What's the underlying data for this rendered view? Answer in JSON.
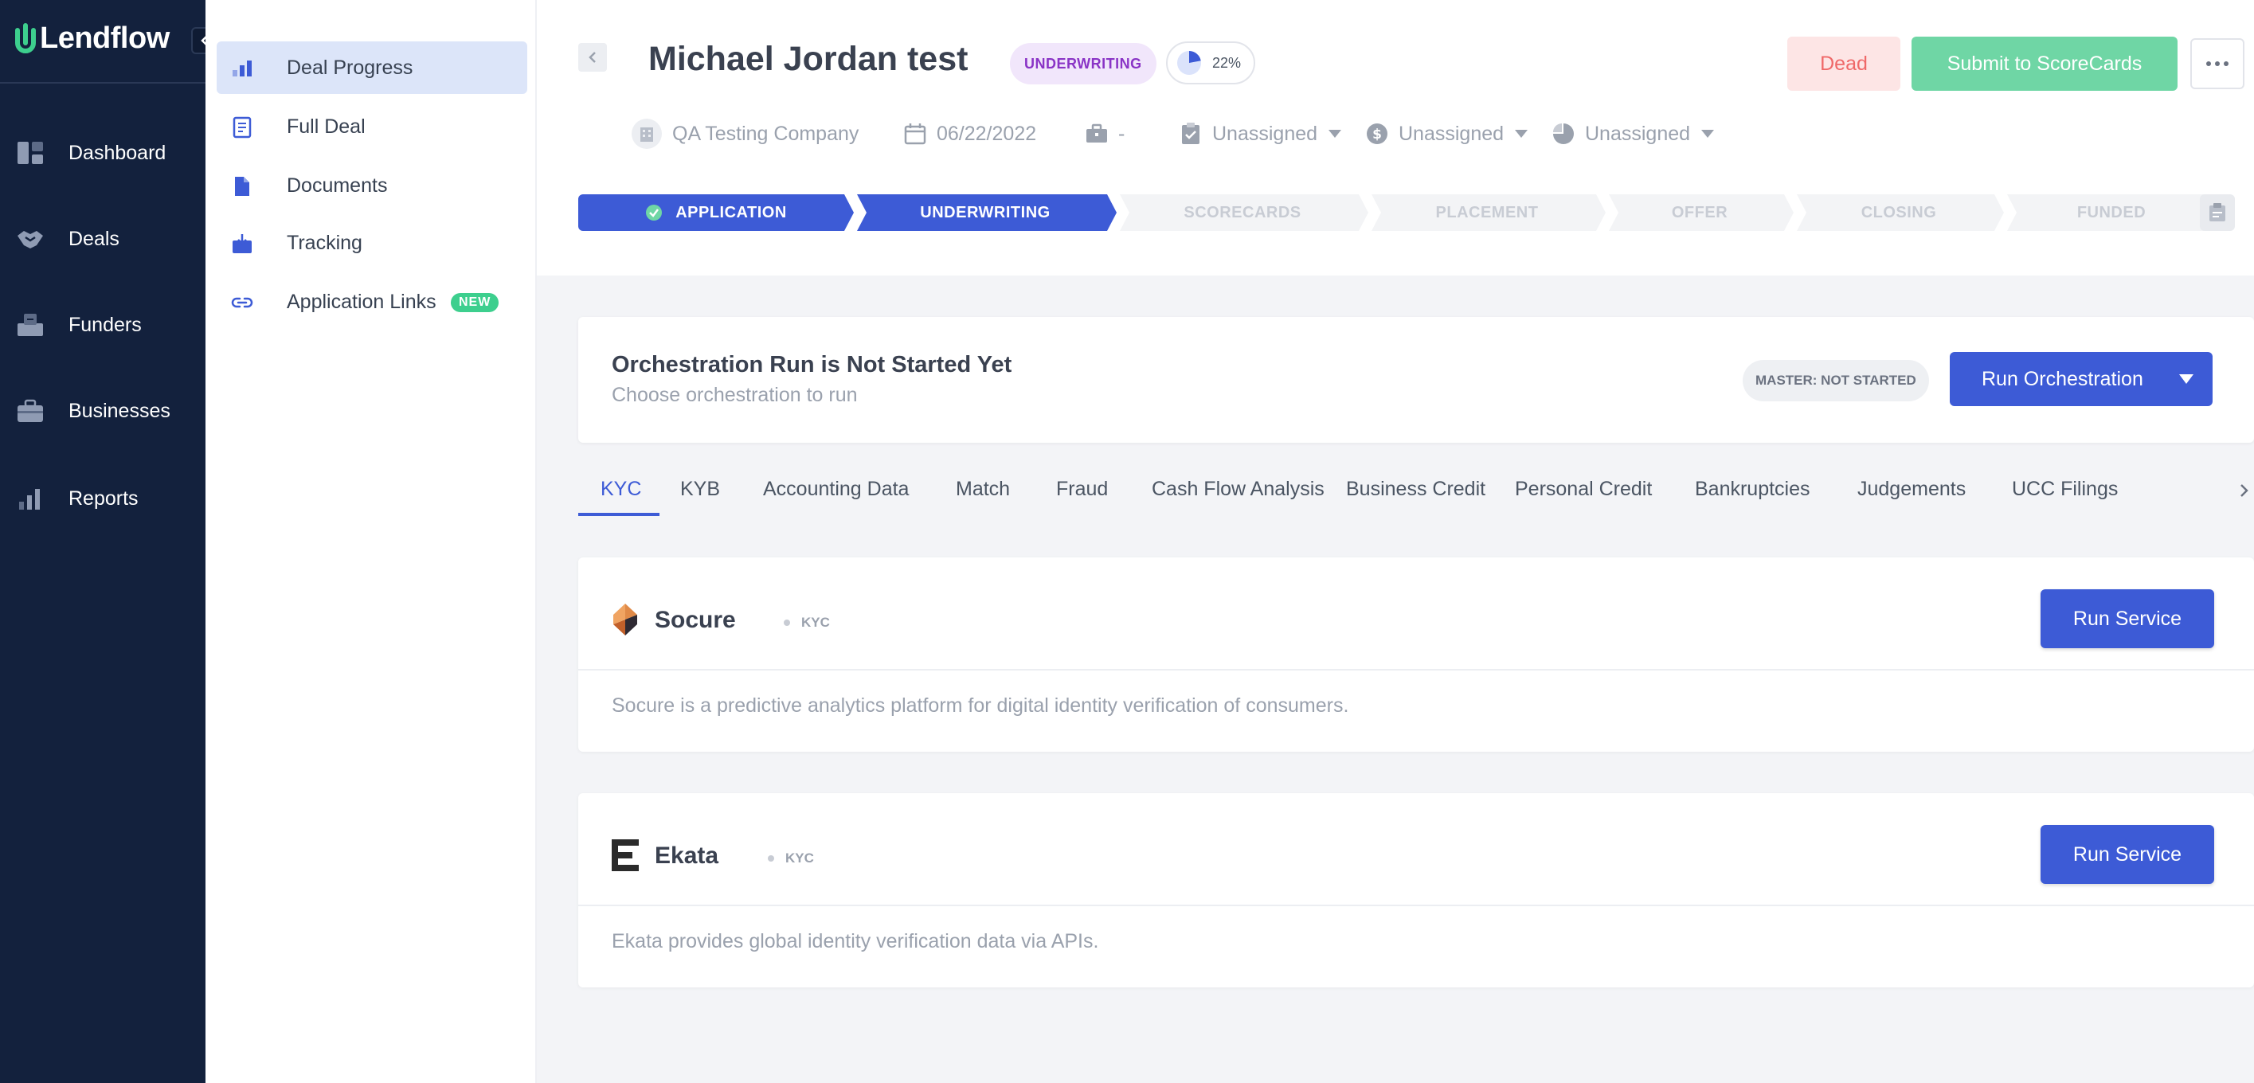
{
  "brand": {
    "name": "Lendflow"
  },
  "leftnav": {
    "items": [
      {
        "label": "Dashboard"
      },
      {
        "label": "Deals"
      },
      {
        "label": "Funders"
      },
      {
        "label": "Businesses"
      },
      {
        "label": "Reports"
      }
    ]
  },
  "subnav": {
    "items": [
      {
        "label": "Deal Progress",
        "active": true
      },
      {
        "label": "Full Deal"
      },
      {
        "label": "Documents"
      },
      {
        "label": "Tracking"
      },
      {
        "label": "Application Links",
        "badge": "NEW"
      }
    ]
  },
  "deal": {
    "title": "Michael Jordan test",
    "stage_badge": "UNDERWRITING",
    "progress_label": "22%",
    "progress": 0.22,
    "company": "QA Testing Company",
    "date": "06/22/2022",
    "industry": "-",
    "assignee_1": "Unassigned",
    "assignee_2": "Unassigned",
    "assignee_3": "Unassigned"
  },
  "actions": {
    "dead": "Dead",
    "submit": "Submit to ScoreCards"
  },
  "pipeline": {
    "steps": [
      {
        "label": "APPLICATION",
        "state": "done"
      },
      {
        "label": "UNDERWRITING",
        "state": "current"
      },
      {
        "label": "SCORECARDS",
        "state": "future"
      },
      {
        "label": "PLACEMENT",
        "state": "future"
      },
      {
        "label": "OFFER",
        "state": "future"
      },
      {
        "label": "CLOSING",
        "state": "future"
      },
      {
        "label": "FUNDED",
        "state": "future"
      }
    ]
  },
  "orchestration": {
    "title": "Orchestration Run is Not Started Yet",
    "subtitle": "Choose orchestration to run",
    "master_badge": "MASTER: NOT STARTED",
    "run_button": "Run Orchestration"
  },
  "tabs": [
    {
      "label": "KYC",
      "active": true
    },
    {
      "label": "KYB"
    },
    {
      "label": "Accounting Data"
    },
    {
      "label": "Match"
    },
    {
      "label": "Fraud"
    },
    {
      "label": "Cash Flow Analysis"
    },
    {
      "label": "Business Credit"
    },
    {
      "label": "Personal Credit"
    },
    {
      "label": "Bankruptcies"
    },
    {
      "label": "Judgements"
    },
    {
      "label": "UCC Filings"
    }
  ],
  "services": [
    {
      "name": "Socure",
      "tag": "KYC",
      "button": "Run Service",
      "description": "Socure is a predictive analytics platform for digital identity verification of consumers."
    },
    {
      "name": "Ekata",
      "tag": "KYC",
      "button": "Run Service",
      "description": "Ekata provides global identity verification data via APIs."
    }
  ],
  "colors": {
    "nav_bg": "#13213d",
    "accent": "#3d5bd6",
    "success": "#6fd6a5",
    "danger": "#ef6868",
    "stage_purple": "#8a34c6"
  }
}
